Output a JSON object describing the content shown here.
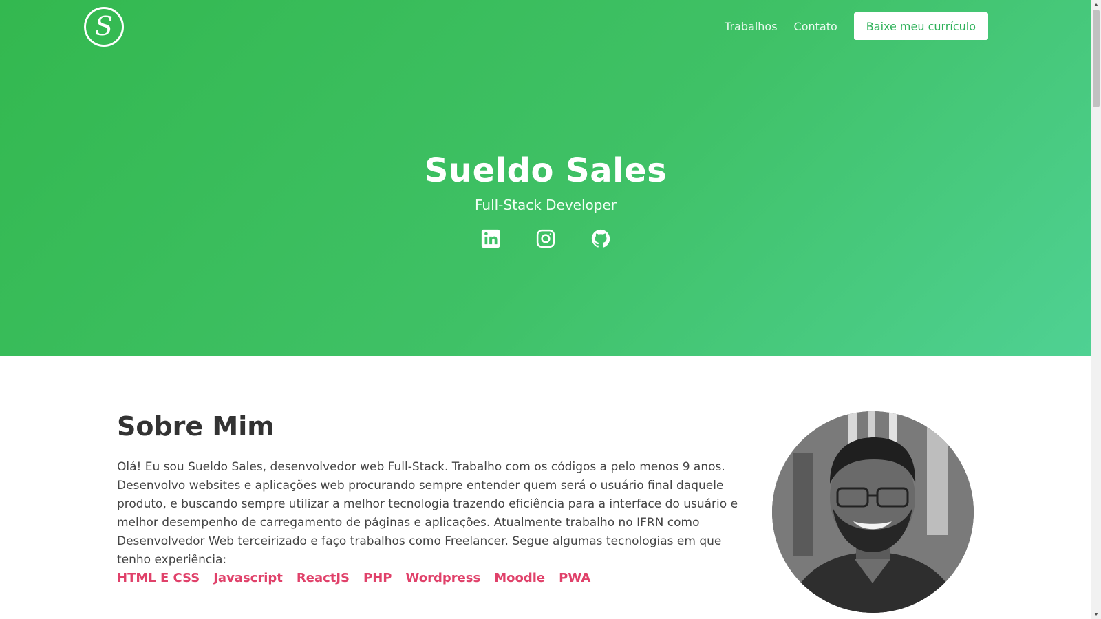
{
  "header": {
    "logo_letter": "S",
    "nav": [
      {
        "label": "Trabalhos"
      },
      {
        "label": "Contato"
      }
    ],
    "cta_label": "Baixe meu currículo"
  },
  "hero": {
    "name": "Sueldo Sales",
    "role": "Full-Stack Developer",
    "socials": [
      {
        "icon": "linkedin-icon"
      },
      {
        "icon": "instagram-icon"
      },
      {
        "icon": "github-icon"
      }
    ]
  },
  "about": {
    "title": "Sobre Mim",
    "text": "Olá! Eu sou Sueldo Sales, desenvolvedor web Full-Stack. Trabalho com os códigos a pelo menos 9 anos. Desenvolvo websites e aplicações web procurando sempre entender quem será o usuário final daquele produto, e buscando sempre utilizar a melhor tecnologia trazendo eficiência para a interface do usuário e melhor desempenho de carregamento de páginas e aplicações. Atualmente trabalho no IFRN como Desenvolvedor Web terceirizado e faço trabalhos como Freelancer. Segue algumas tecnologias em que tenho experiência:",
    "tags": [
      "HTML E CSS",
      "Javascript",
      "ReactJS",
      "PHP",
      "Wordpress",
      "Moodle",
      "PWA"
    ]
  },
  "colors": {
    "hero_green": "#3fc166",
    "tag_pink": "#e0416a",
    "button_text": "#2fb15a"
  }
}
